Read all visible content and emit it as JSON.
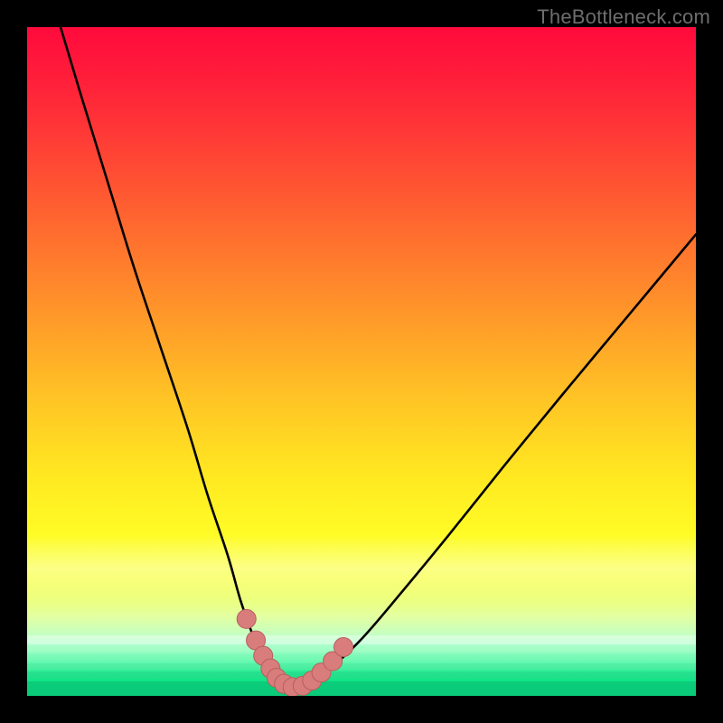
{
  "watermark": {
    "text": "TheBottleneck.com"
  },
  "colors": {
    "frame": "#000000",
    "curve": "#000000",
    "marker_fill": "#d87c7c",
    "marker_stroke": "#b85e5e",
    "gradient_top": "#ff0a3c",
    "gradient_bottom": "#05d77a"
  },
  "chart_data": {
    "type": "line",
    "title": "",
    "xlabel": "",
    "ylabel": "",
    "xlim": [
      0,
      100
    ],
    "ylim": [
      0,
      100
    ],
    "note": "Axes are unlabeled in the image; values below are pixel-proportional estimates (0–100) read from the figure.",
    "series": [
      {
        "name": "bottleneck-curve",
        "x": [
          5,
          8,
          12,
          16,
          20,
          24,
          27,
          30,
          32,
          34,
          36,
          37.5,
          39.5,
          42,
          45,
          50,
          56,
          63,
          71,
          80,
          90,
          100
        ],
        "values": [
          100,
          90,
          77,
          64,
          52,
          40,
          30,
          21,
          14,
          8.5,
          4.5,
          2.3,
          1.2,
          1.6,
          3.8,
          8.5,
          15.5,
          24,
          34,
          45,
          57,
          69
        ]
      }
    ],
    "markers": {
      "name": "highlighted-points",
      "x": [
        32.8,
        34.2,
        35.3,
        36.4,
        37.3,
        38.4,
        39.7,
        41.2,
        42.6,
        44.0,
        45.7,
        47.3
      ],
      "values": [
        11.5,
        8.3,
        6.0,
        4.1,
        2.7,
        1.8,
        1.3,
        1.5,
        2.3,
        3.5,
        5.2,
        7.3
      ]
    },
    "legend": [],
    "grid": false
  }
}
